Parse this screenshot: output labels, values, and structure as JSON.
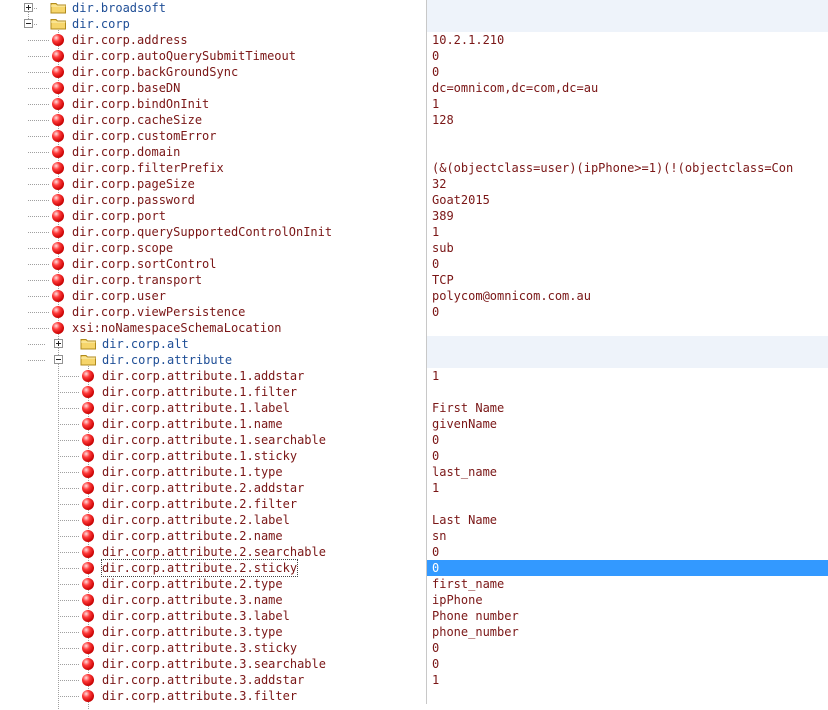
{
  "tree": [
    {
      "kind": "folder",
      "label": "dir.broadsoft",
      "level": 0,
      "expanded": false,
      "value": ""
    },
    {
      "kind": "folder",
      "label": "dir.corp",
      "level": 0,
      "expanded": true,
      "value": ""
    },
    {
      "kind": "prop",
      "label": "dir.corp.address",
      "level": 1,
      "value": "10.2.1.210"
    },
    {
      "kind": "prop",
      "label": "dir.corp.autoQuerySubmitTimeout",
      "level": 1,
      "value": "0"
    },
    {
      "kind": "prop",
      "label": "dir.corp.backGroundSync",
      "level": 1,
      "value": "0"
    },
    {
      "kind": "prop",
      "label": "dir.corp.baseDN",
      "level": 1,
      "value": "dc=omnicom,dc=com,dc=au"
    },
    {
      "kind": "prop",
      "label": "dir.corp.bindOnInit",
      "level": 1,
      "value": "1"
    },
    {
      "kind": "prop",
      "label": "dir.corp.cacheSize",
      "level": 1,
      "value": "128"
    },
    {
      "kind": "prop",
      "label": "dir.corp.customError",
      "level": 1,
      "value": ""
    },
    {
      "kind": "prop",
      "label": "dir.corp.domain",
      "level": 1,
      "value": ""
    },
    {
      "kind": "prop",
      "label": "dir.corp.filterPrefix",
      "level": 1,
      "value": "(&(objectclass=user)(ipPhone>=1)(!(objectclass=Con"
    },
    {
      "kind": "prop",
      "label": "dir.corp.pageSize",
      "level": 1,
      "value": "32"
    },
    {
      "kind": "prop",
      "label": "dir.corp.password",
      "level": 1,
      "value": "Goat2015"
    },
    {
      "kind": "prop",
      "label": "dir.corp.port",
      "level": 1,
      "value": "389"
    },
    {
      "kind": "prop",
      "label": "dir.corp.querySupportedControlOnInit",
      "level": 1,
      "value": "1"
    },
    {
      "kind": "prop",
      "label": "dir.corp.scope",
      "level": 1,
      "value": "sub"
    },
    {
      "kind": "prop",
      "label": "dir.corp.sortControl",
      "level": 1,
      "value": "0"
    },
    {
      "kind": "prop",
      "label": "dir.corp.transport",
      "level": 1,
      "value": "TCP"
    },
    {
      "kind": "prop",
      "label": "dir.corp.user",
      "level": 1,
      "value": "polycom@omnicom.com.au"
    },
    {
      "kind": "prop",
      "label": "dir.corp.viewPersistence",
      "level": 1,
      "value": "0"
    },
    {
      "kind": "prop",
      "label": "xsi:noNamespaceSchemaLocation",
      "level": 1,
      "value": ""
    },
    {
      "kind": "folder",
      "label": "dir.corp.alt",
      "level": 1,
      "expanded": false,
      "value": ""
    },
    {
      "kind": "folder",
      "label": "dir.corp.attribute",
      "level": 1,
      "expanded": true,
      "value": ""
    },
    {
      "kind": "prop",
      "label": "dir.corp.attribute.1.addstar",
      "level": 2,
      "value": "1"
    },
    {
      "kind": "prop",
      "label": "dir.corp.attribute.1.filter",
      "level": 2,
      "value": ""
    },
    {
      "kind": "prop",
      "label": "dir.corp.attribute.1.label",
      "level": 2,
      "value": "First Name"
    },
    {
      "kind": "prop",
      "label": "dir.corp.attribute.1.name",
      "level": 2,
      "value": "givenName"
    },
    {
      "kind": "prop",
      "label": "dir.corp.attribute.1.searchable",
      "level": 2,
      "value": "0"
    },
    {
      "kind": "prop",
      "label": "dir.corp.attribute.1.sticky",
      "level": 2,
      "value": "0"
    },
    {
      "kind": "prop",
      "label": "dir.corp.attribute.1.type",
      "level": 2,
      "value": "last_name"
    },
    {
      "kind": "prop",
      "label": "dir.corp.attribute.2.addstar",
      "level": 2,
      "value": "1"
    },
    {
      "kind": "prop",
      "label": "dir.corp.attribute.2.filter",
      "level": 2,
      "value": ""
    },
    {
      "kind": "prop",
      "label": "dir.corp.attribute.2.label",
      "level": 2,
      "value": "Last Name"
    },
    {
      "kind": "prop",
      "label": "dir.corp.attribute.2.name",
      "level": 2,
      "value": "sn"
    },
    {
      "kind": "prop",
      "label": "dir.corp.attribute.2.searchable",
      "level": 2,
      "value": "0"
    },
    {
      "kind": "prop",
      "label": "dir.corp.attribute.2.sticky",
      "level": 2,
      "value": "0",
      "selected": true
    },
    {
      "kind": "prop",
      "label": "dir.corp.attribute.2.type",
      "level": 2,
      "value": "first_name"
    },
    {
      "kind": "prop",
      "label": "dir.corp.attribute.3.name",
      "level": 2,
      "value": "ipPhone"
    },
    {
      "kind": "prop",
      "label": "dir.corp.attribute.3.label",
      "level": 2,
      "value": "Phone number"
    },
    {
      "kind": "prop",
      "label": "dir.corp.attribute.3.type",
      "level": 2,
      "value": "phone_number"
    },
    {
      "kind": "prop",
      "label": "dir.corp.attribute.3.sticky",
      "level": 2,
      "value": "0"
    },
    {
      "kind": "prop",
      "label": "dir.corp.attribute.3.searchable",
      "level": 2,
      "value": "0"
    },
    {
      "kind": "prop",
      "label": "dir.corp.attribute.3.addstar",
      "level": 2,
      "value": "1"
    },
    {
      "kind": "prop",
      "label": "dir.corp.attribute.3.filter",
      "level": 2,
      "value": ""
    }
  ],
  "colors": {
    "folder_label": "#1f4e96",
    "prop_label": "#7a1616",
    "value_text": "#7a1616",
    "selection": "#3399ff",
    "folder_band": "#eef3fa"
  },
  "icons": {
    "folder": "folder-icon",
    "property": "red-ball-icon",
    "expand": "plus-icon",
    "collapse": "minus-icon"
  }
}
